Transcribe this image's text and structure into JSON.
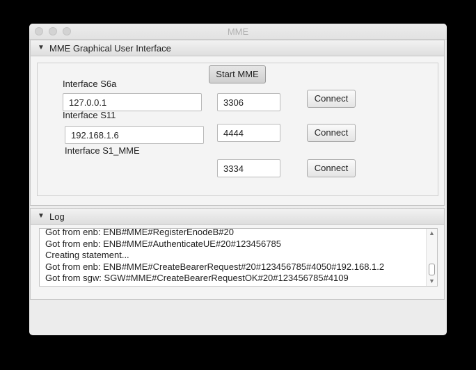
{
  "window": {
    "title": "MME"
  },
  "panes": {
    "gui": {
      "header": "MME Graphical User Interface",
      "arrow": "▼"
    },
    "log": {
      "header": "Log",
      "arrow": "▼"
    }
  },
  "start_button": "Start MME",
  "interfaces": {
    "s6a": {
      "label": "Interface S6a",
      "ip": "127.0.0.1",
      "port": "3306",
      "connect": "Connect"
    },
    "s11": {
      "label": "Interface S11",
      "ip": "192.168.1.6",
      "port": "4444",
      "connect": "Connect"
    },
    "s1mme": {
      "label": "Interface S1_MME",
      "port": "3334",
      "connect": "Connect"
    }
  },
  "log": {
    "lines": [
      "Got from enb: ENB#MME#RegisterEnodeB#20",
      "Got from enb: ENB#MME#AuthenticateUE#20#123456785",
      "Creating statement...",
      "Got from enb: ENB#MME#CreateBearerRequest#20#123456785#4050#192.168.1.2",
      "Got from sgw: SGW#MME#CreateBearerRequestOK#20#123456785#4109"
    ],
    "scroll_up": "▲",
    "scroll_down": "▼"
  }
}
